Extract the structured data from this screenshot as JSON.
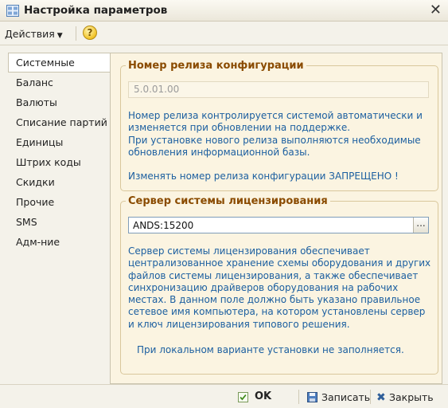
{
  "window": {
    "title": "Настройка параметров",
    "icon": "settings-form-icon",
    "close_glyph": "✕"
  },
  "toolbar": {
    "actions_label": "Действия",
    "help_label": "?"
  },
  "sidebar": {
    "items": [
      {
        "label": "Системные"
      },
      {
        "label": "Баланс"
      },
      {
        "label": "Валюты"
      },
      {
        "label": "Списание партий"
      },
      {
        "label": "Единицы"
      },
      {
        "label": "Штрих коды"
      },
      {
        "label": "Скидки"
      },
      {
        "label": "Прочие"
      },
      {
        "label": "SMS"
      },
      {
        "label": "Адм-ние"
      }
    ],
    "active": "Системные"
  },
  "release_group": {
    "legend": "Номер релиза конфигурации",
    "value": "5.0.01.00",
    "desc_lines": [
      "Номер релиза контролируется системой автоматически и изменяется при обновлении на поддержке.",
      "При установке нового релиза выполняются необходимые обновления информационной базы."
    ],
    "warning": "Изменять номер релиза конфигурации ЗАПРЕЩЕНО !"
  },
  "license_group": {
    "legend": "Сервер системы лицензирования",
    "value": "ANDS:15200",
    "button_label": "...",
    "description": "Сервер системы лицензирования обеспечивает централизованное хранение схемы оборудования и других файлов системы лицензирования, а также обеспечивает синхронизацию драйверов оборудования на рабочих местах. В данном поле должно быть указано правильное сетевое имя компьютера, на котором установлены сервер и ключ лицензирования типового решения.",
    "local_note": "При локальном варианте установки не заполняется."
  },
  "bottombar": {
    "ok_label": "OK",
    "save_label": "Записать",
    "close_label": "Закрыть"
  },
  "colors": {
    "legend": "#8a4b00",
    "description": "#1c5fa0",
    "panel_bg": "#fbf4e1",
    "window_bg": "#f4f2ea"
  }
}
